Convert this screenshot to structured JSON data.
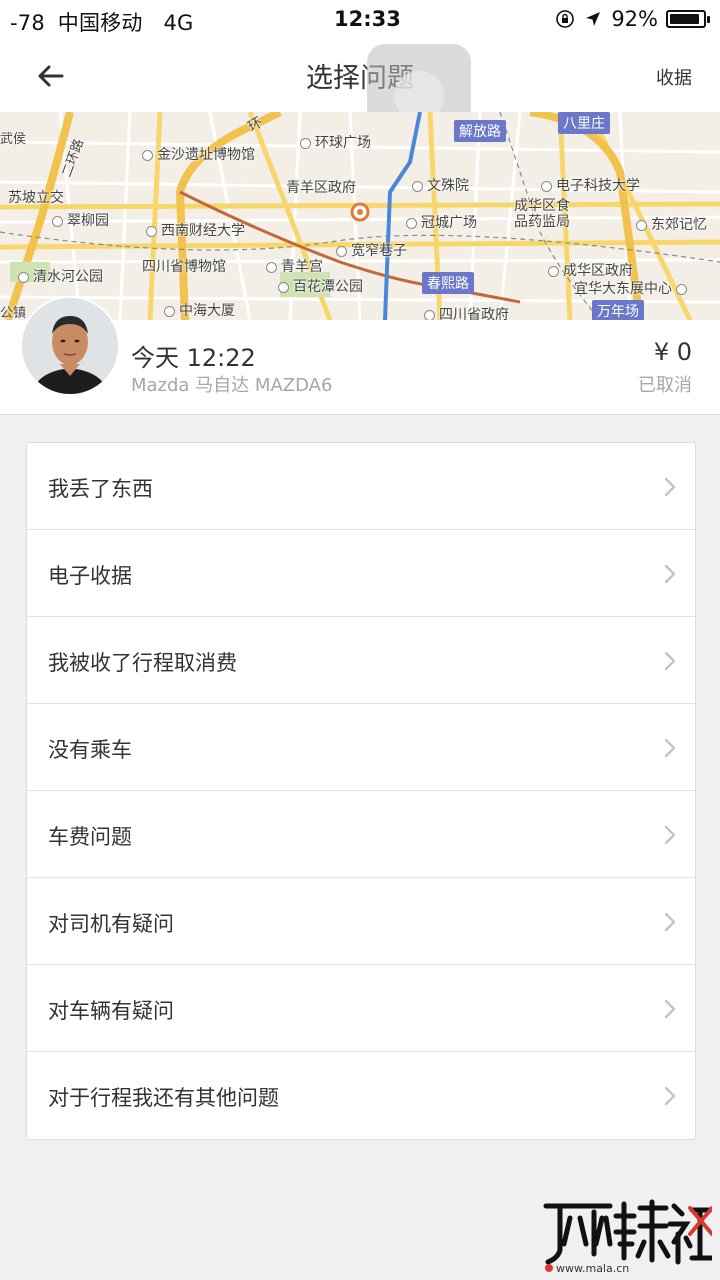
{
  "status_bar": {
    "signal": "-78",
    "carrier": "中国移动",
    "network": "4G",
    "time": "12:33",
    "battery": "92%",
    "battery_level": 0.92
  },
  "nav": {
    "title": "选择问题",
    "right_label": "收据",
    "back_icon": "arrow-left-icon"
  },
  "map": {
    "labels": [
      "金沙遗址博物馆",
      "环球广场",
      "解放路",
      "八里庄",
      "电子科技大学",
      "青羊区政府",
      "文殊院",
      "苏坡立交",
      "翠柳园",
      "西南财经大学",
      "冠城广场",
      "成华区食品药监局",
      "东郊记忆",
      "宽窄巷子",
      "四川省博物馆",
      "青羊宫",
      "清水河公园",
      "百花潭公园",
      "春熙路",
      "成华区政府",
      "宜华大东展中心",
      "中海大厦",
      "四川省政府",
      "万年场",
      "环",
      "二环路",
      "武侯",
      "公镇"
    ]
  },
  "trip": {
    "time": "今天 12:22",
    "car": "Mazda 马自达 MAZDA6",
    "fare": "¥ 0",
    "status": "已取消"
  },
  "issues": [
    "我丢了东西",
    "电子收据",
    "我被收了行程取消费",
    "没有乘车",
    "车费问题",
    "对司机有疑问",
    "对车辆有疑问",
    "对于行程我还有其他问题"
  ],
  "watermark": {
    "brand": "麻辣社区",
    "url": "www.mala.cn"
  },
  "colors": {
    "background": "#f0f0f2",
    "chevron": "#c4c4c8",
    "map_tag": "#6b78c9",
    "ring_road": "#f2c24e"
  }
}
